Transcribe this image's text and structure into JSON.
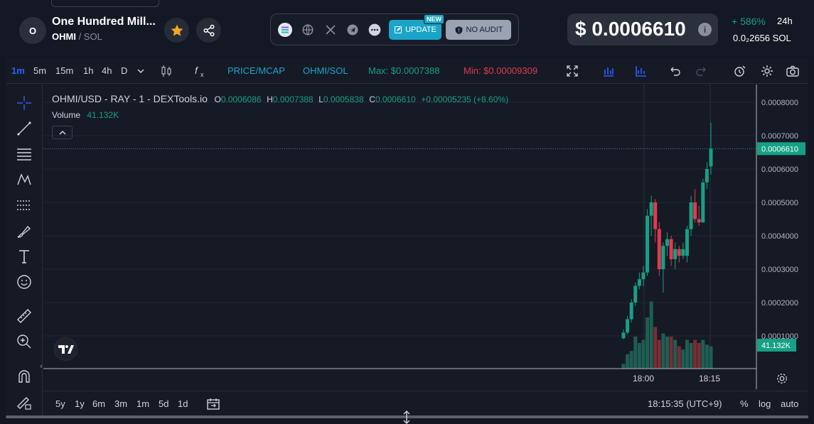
{
  "header": {
    "avatar_letter": "O",
    "token_name": "One Hundred Mill...",
    "token_symbol": "OHMI",
    "pair_separator": " / ",
    "pair_quote": "SOL",
    "favorite_icon": "star-icon",
    "share_icon": "share-icon",
    "social_icons": [
      "solana-icon",
      "globe-icon",
      "x-icon",
      "telegram-icon",
      "more-icon"
    ],
    "update_label": "UPDATE",
    "new_badge": "NEW",
    "audit_label": "NO AUDIT",
    "price": "$ 0.0006610",
    "change": "+ 586%",
    "change_period": "24h",
    "price_sol": "0.0₂2656",
    "price_sol_unit": "SOL",
    "accent_color": "#1aa5c8",
    "up_color": "#16a085",
    "down_color": "#e03a4e"
  },
  "toolbar": {
    "intervals": [
      "1m",
      "5m",
      "15m",
      "1h",
      "4h",
      "D"
    ],
    "active_interval": "1m",
    "price_mcap": "PRICE/MCAP",
    "pair_toggle": "OHMI/SOL",
    "max_label": "Max: $0.0007388",
    "min_label": "Min: $0.00009309"
  },
  "legend": {
    "symbol": "OHMI/USD - RAY - 1 - DEXTools.io",
    "o_label": "O",
    "o_val": "0.0006086",
    "h_label": "H",
    "h_val": "0.0007388",
    "l_label": "L",
    "l_val": "0.0005838",
    "c_label": "C",
    "c_val": "0.0006610",
    "change": "+0.00005235 (+8.60%)",
    "volume_label": "Volume",
    "volume_val": "41.132K"
  },
  "chart_data": {
    "type": "candlestick",
    "y_ticks": [
      "0.0008000",
      "0.0007000",
      "0.0006000",
      "0.0005000",
      "0.0004000",
      "0.0003000",
      "0.0002000",
      "0.0001000"
    ],
    "ylim": [
      0.0,
      0.00085
    ],
    "x_ticks": [
      "18:00",
      "18:15"
    ],
    "last_price_label": "0.0006610",
    "volume_label": "41.132K",
    "candles": [
      {
        "o": 9.3e-05,
        "h": 0.00012,
        "l": 9e-05,
        "c": 0.00011
      },
      {
        "o": 0.00011,
        "h": 0.00016,
        "l": 0.000105,
        "c": 0.00015
      },
      {
        "o": 0.00015,
        "h": 0.00021,
        "l": 0.00014,
        "c": 0.0002
      },
      {
        "o": 0.0002,
        "h": 0.00026,
        "l": 0.00019,
        "c": 0.00025
      },
      {
        "o": 0.00025,
        "h": 0.00029,
        "l": 0.00024,
        "c": 0.00027
      },
      {
        "o": 0.00027,
        "h": 0.00031,
        "l": 0.00025,
        "c": 0.00029
      },
      {
        "o": 0.00029,
        "h": 0.00048,
        "l": 0.00028,
        "c": 0.00046
      },
      {
        "o": 0.00046,
        "h": 0.00052,
        "l": 0.0004,
        "c": 0.0005
      },
      {
        "o": 0.0005,
        "h": 0.00051,
        "l": 0.00038,
        "c": 0.00042
      },
      {
        "o": 0.00042,
        "h": 0.00044,
        "l": 0.00028,
        "c": 0.0003
      },
      {
        "o": 0.0003,
        "h": 0.00038,
        "l": 0.00023,
        "c": 0.00037
      },
      {
        "o": 0.00037,
        "h": 0.00041,
        "l": 0.00034,
        "c": 0.00039
      },
      {
        "o": 0.00039,
        "h": 0.0004,
        "l": 0.00031,
        "c": 0.00033
      },
      {
        "o": 0.00033,
        "h": 0.00038,
        "l": 0.0003,
        "c": 0.00036
      },
      {
        "o": 0.00036,
        "h": 0.00037,
        "l": 0.00032,
        "c": 0.00034
      },
      {
        "o": 0.00034,
        "h": 0.00038,
        "l": 0.00033,
        "c": 0.00036
      },
      {
        "o": 0.00034,
        "h": 0.00043,
        "l": 0.00032,
        "c": 0.00042
      },
      {
        "o": 0.00042,
        "h": 0.00052,
        "l": 0.0004,
        "c": 0.0005
      },
      {
        "o": 0.0005,
        "h": 0.00054,
        "l": 0.00044,
        "c": 0.00045
      },
      {
        "o": 0.00045,
        "h": 0.00049,
        "l": 0.00043,
        "c": 0.00044
      },
      {
        "o": 0.00044,
        "h": 0.00057,
        "l": 0.00044,
        "c": 0.00056
      },
      {
        "o": 0.00056,
        "h": 0.00062,
        "l": 0.00054,
        "c": 0.0006
      },
      {
        "o": 0.000608,
        "h": 0.000739,
        "l": 0.000584,
        "c": 0.000661
      }
    ],
    "volumes": [
      0.15,
      0.45,
      0.55,
      1.0,
      0.8,
      0.9,
      1.6,
      2.1,
      1.3,
      0.9,
      1.1,
      1.0,
      1.0,
      0.9,
      0.7,
      0.6,
      0.9,
      0.8,
      0.9,
      0.8,
      0.9,
      0.75,
      0.7
    ]
  },
  "bottombar": {
    "ranges": [
      "5y",
      "1y",
      "6m",
      "3m",
      "1m",
      "5d",
      "1d"
    ],
    "time": "18:15:35 (UTC+9)",
    "pct": "%",
    "log": "log",
    "auto": "auto"
  }
}
